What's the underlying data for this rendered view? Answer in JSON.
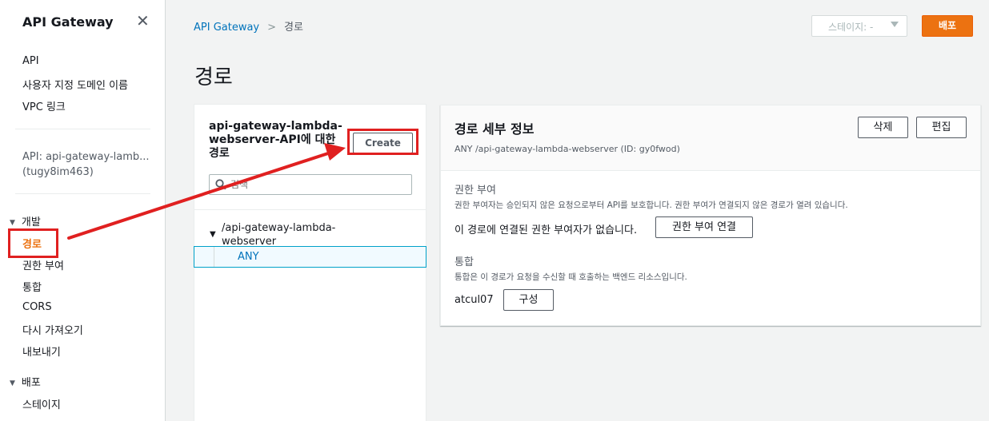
{
  "sidebar": {
    "title": "API Gateway",
    "close_icon": "close-icon",
    "links": [
      "API",
      "사용자 지정 도메인 이름",
      "VPC 링크"
    ],
    "api_name_line1": "API: api-gateway-lamb...",
    "api_name_line2": "(tugy8im463)",
    "section_dev": "개발",
    "dev_items": [
      "경로",
      "권한 부여",
      "통합",
      "CORS",
      "다시 가져오기",
      "내보내기"
    ],
    "section_deploy": "배포",
    "deploy_items": [
      "스테이지"
    ]
  },
  "breadcrumb": {
    "root": "API Gateway",
    "current": "경로"
  },
  "header": {
    "stage_select": "스테이지: -",
    "deploy_button": "배포"
  },
  "page": {
    "title": "경로"
  },
  "routes_panel": {
    "title": "api-gateway-lambda-webserver-API에 대한 경로",
    "create_button": "Create",
    "search_placeholder": "검색",
    "route_path": "/api-gateway-lambda-webserver",
    "route_method": "ANY"
  },
  "details_panel": {
    "title": "경로 세부 정보",
    "subtitle": "ANY /api-gateway-lambda-webserver (ID: gy0fwod)",
    "delete_button": "삭제",
    "edit_button": "편집",
    "auth_label": "권한 부여",
    "auth_desc": "권한 부여자는 승인되지 않은 요청으로부터 API를 보호합니다. 권한 부여가 연결되지 않은 경로가 열려 있습니다.",
    "auth_status": "이 경로에 연결된 권한 부여자가 없습니다.",
    "auth_attach_button": "권한 부여 연결",
    "integration_label": "통합",
    "integration_desc": "통합은 이 경로가 요청을 수신할 때 호출하는 백엔드 리소스입니다.",
    "integration_target": "atcul07",
    "configure_button": "구성"
  },
  "annotations": {
    "highlight_color": "#e02020"
  },
  "colors": {
    "accent": "#ec7211",
    "link": "#0073bb",
    "selected_border": "#00a1c9"
  }
}
